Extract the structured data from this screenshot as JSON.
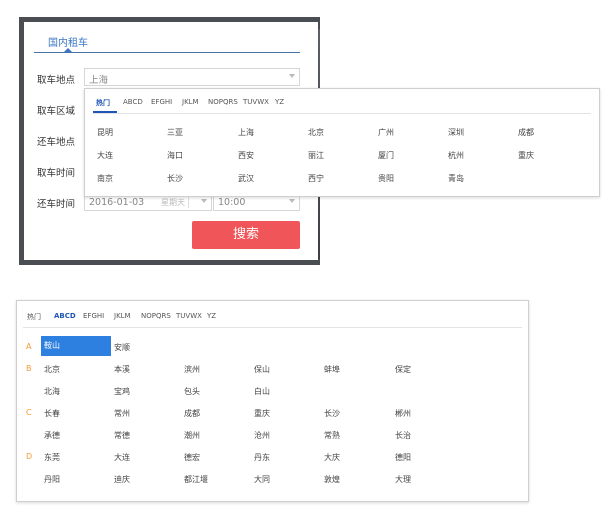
{
  "form": {
    "tab": "国内租车",
    "fields": [
      {
        "label": "取车地点",
        "value": "上海"
      },
      {
        "label": "取车区域",
        "value": ""
      },
      {
        "label": "还车地点",
        "value": ""
      },
      {
        "label": "取车时间",
        "value": ""
      },
      {
        "label": "还车时间",
        "value": "2016-01-03",
        "sub": "星期天",
        "time": "10:00"
      }
    ],
    "search_label": "搜索"
  },
  "popup1": {
    "tabs": [
      "热门",
      "ABCD",
      "EFGHI",
      "JKLM",
      "NOPQRS",
      "TUVWX",
      "YZ"
    ],
    "active_tab": "热门",
    "cities": [
      [
        "昆明",
        "三亚",
        "上海",
        "北京",
        "广州",
        "深圳",
        "成都"
      ],
      [
        "大连",
        "海口",
        "西安",
        "丽江",
        "厦门",
        "杭州",
        "重庆"
      ],
      [
        "南京",
        "长沙",
        "武汉",
        "西宁",
        "贵阳",
        "青岛"
      ]
    ]
  },
  "popup2": {
    "tabs": [
      "热门",
      "ABCD",
      "EFGHI",
      "JKLM",
      "NOPQRS",
      "TUVWX",
      "YZ"
    ],
    "active_tab": "ABCD",
    "groups": [
      {
        "letter": "A",
        "rows": [
          [
            "鞍山",
            "安顺"
          ]
        ]
      },
      {
        "letter": "B",
        "rows": [
          [
            "北京",
            "本溪",
            "滨州",
            "保山",
            "蚌埠",
            "保定"
          ],
          [
            "北海",
            "宝鸡",
            "包头",
            "白山"
          ]
        ]
      },
      {
        "letter": "C",
        "rows": [
          [
            "长春",
            "常州",
            "成都",
            "重庆",
            "长沙",
            "郴州"
          ],
          [
            "承德",
            "常德",
            "潮州",
            "沧州",
            "常熟",
            "长治"
          ]
        ]
      },
      {
        "letter": "D",
        "rows": [
          [
            "东莞",
            "大连",
            "德宏",
            "丹东",
            "大庆",
            "德阳"
          ],
          [
            "丹阳",
            "迪庆",
            "都江堰",
            "大同",
            "敦煌",
            "大理"
          ]
        ]
      }
    ],
    "selected": "鞍山"
  },
  "colors": {
    "accent": "#1e56b5",
    "button": "#f0555a",
    "letter": "#f29a38",
    "selected": "#2d7fe0"
  }
}
